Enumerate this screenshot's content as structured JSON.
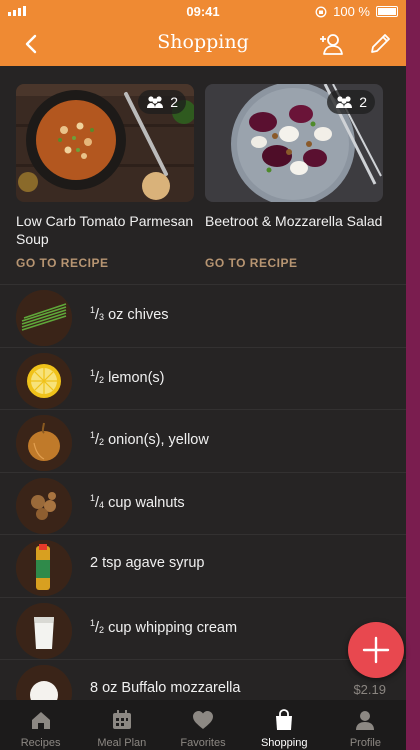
{
  "status": {
    "time": "09:41",
    "battery": "100 %"
  },
  "header": {
    "title": "Shopping"
  },
  "recipes": [
    {
      "name": "Low Carb Tomato Parmesan Soup",
      "servings": "2",
      "link": "GO TO RECIPE"
    },
    {
      "name": "Beetroot & Mozzarella Salad",
      "servings": "2",
      "link": "GO TO RECIPE"
    }
  ],
  "ingredients": [
    {
      "num": "1",
      "den": "3",
      "text": "oz chives",
      "price": ""
    },
    {
      "num": "1",
      "den": "2",
      "text": " lemon(s)",
      "price": ""
    },
    {
      "num": "1",
      "den": "2",
      "text": " onion(s), yellow",
      "price": ""
    },
    {
      "num": "1",
      "den": "4",
      "text": "cup walnuts",
      "price": ""
    },
    {
      "num": "",
      "den": "",
      "text": "2 tsp agave syrup",
      "price": ""
    },
    {
      "num": "1",
      "den": "2",
      "text": "cup whipping cream",
      "price": ""
    },
    {
      "num": "",
      "den": "",
      "text": "8 oz Buffalo mozzarella",
      "price": "$2.19"
    }
  ],
  "tabs": [
    {
      "label": "Recipes",
      "icon": "home-icon"
    },
    {
      "label": "Meal Plan",
      "icon": "calendar-icon"
    },
    {
      "label": "Favorites",
      "icon": "heart-icon"
    },
    {
      "label": "Shopping",
      "icon": "shopping-bag-icon"
    },
    {
      "label": "Profile",
      "icon": "person-icon"
    }
  ],
  "colors": {
    "accent": "#ef8a33",
    "fab": "#e8484f",
    "link": "#b79572"
  }
}
